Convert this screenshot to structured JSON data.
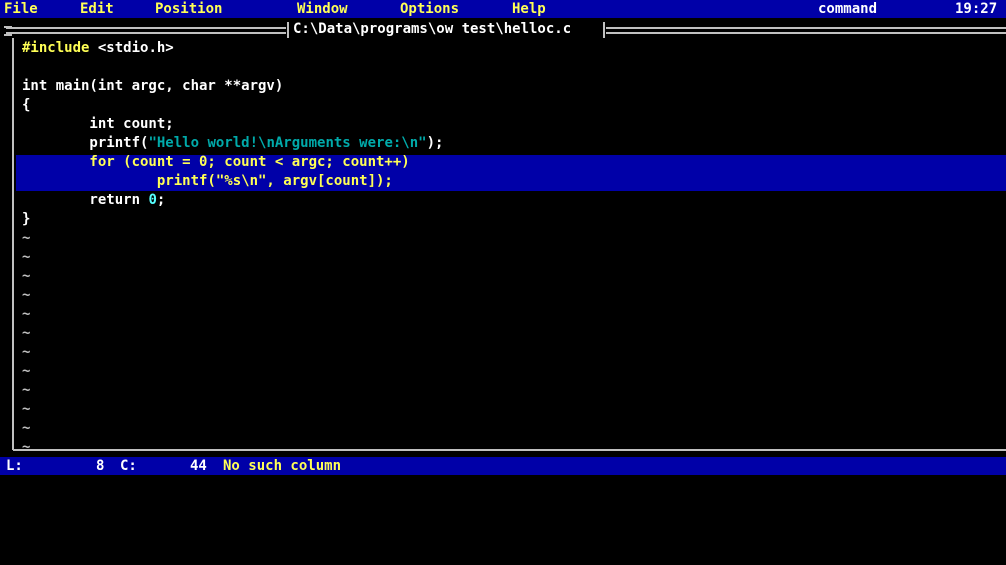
{
  "menu": {
    "items": [
      "File",
      "Edit",
      "Position",
      "Window",
      "Options",
      "Help"
    ],
    "mode": "command",
    "clock": "19:27"
  },
  "window": {
    "title": "C:\\Data\\programs\\ow test\\helloc.c"
  },
  "editor": {
    "lines": [
      {
        "segments": [
          {
            "t": "#include",
            "c": "pp"
          },
          {
            "t": " <stdio.h>",
            "c": "kw"
          }
        ]
      },
      {
        "segments": []
      },
      {
        "segments": [
          {
            "t": "int main(int argc, char **argv)",
            "c": "kw"
          }
        ]
      },
      {
        "segments": [
          {
            "t": "{",
            "c": "kw"
          }
        ]
      },
      {
        "segments": [
          {
            "t": "        int count;",
            "c": "kw"
          }
        ]
      },
      {
        "segments": [
          {
            "t": "        printf(",
            "c": "kw"
          },
          {
            "t": "\"Hello world!\\nArguments were:\\n\"",
            "c": "str"
          },
          {
            "t": ");",
            "c": "kw"
          }
        ]
      },
      {
        "segments": [
          {
            "t": "        for (count = 0; count < argc; count++)",
            "c": "pp"
          }
        ]
      },
      {
        "segments": [
          {
            "t": "                printf(\"%s\\n\", argv[count]);",
            "c": "pp"
          }
        ]
      },
      {
        "segments": [
          {
            "t": "        return ",
            "c": "kw"
          },
          {
            "t": "0",
            "c": "num"
          },
          {
            "t": ";",
            "c": "kw"
          }
        ]
      },
      {
        "segments": [
          {
            "t": "}",
            "c": "kw"
          }
        ]
      },
      {
        "segments": [
          {
            "t": "~",
            "c": "tilde"
          }
        ]
      },
      {
        "segments": [
          {
            "t": "~",
            "c": "tilde"
          }
        ]
      },
      {
        "segments": [
          {
            "t": "~",
            "c": "tilde"
          }
        ]
      },
      {
        "segments": [
          {
            "t": "~",
            "c": "tilde"
          }
        ]
      },
      {
        "segments": [
          {
            "t": "~",
            "c": "tilde"
          }
        ]
      },
      {
        "segments": [
          {
            "t": "~",
            "c": "tilde"
          }
        ]
      },
      {
        "segments": [
          {
            "t": "~",
            "c": "tilde"
          }
        ]
      },
      {
        "segments": [
          {
            "t": "~",
            "c": "tilde"
          }
        ]
      },
      {
        "segments": [
          {
            "t": "~",
            "c": "tilde"
          }
        ]
      },
      {
        "segments": [
          {
            "t": "~",
            "c": "tilde"
          }
        ]
      },
      {
        "segments": [
          {
            "t": "~",
            "c": "tilde"
          }
        ]
      },
      {
        "segments": [
          {
            "t": "~",
            "c": "tilde"
          }
        ]
      }
    ]
  },
  "status": {
    "line_label": "L:",
    "line_value": "8",
    "col_label": "C:",
    "col_value": "44",
    "message": "No such column"
  }
}
